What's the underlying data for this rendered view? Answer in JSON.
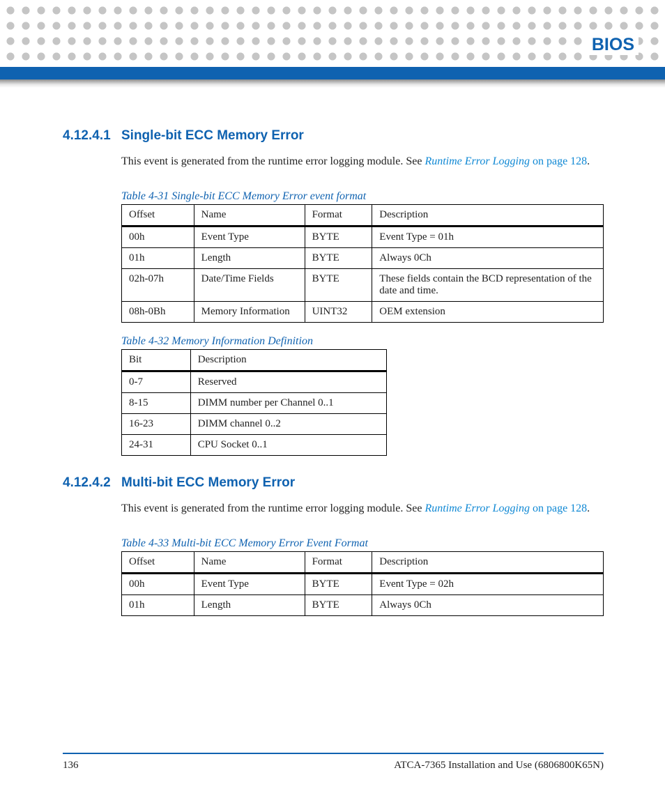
{
  "header": {
    "chapter": "BIOS"
  },
  "sections": [
    {
      "num": "4.12.4.1",
      "title": "Single-bit ECC Memory Error",
      "para_prefix": "This event is generated from the runtime error logging module. See ",
      "xref_text": "Runtime Error Logging",
      "para_mid": " on page 128",
      "para_suffix": "."
    },
    {
      "num": "4.12.4.2",
      "title": "Multi-bit ECC Memory Error",
      "para_prefix": "This event is generated from the runtime error logging module. See ",
      "xref_text": "Runtime Error Logging",
      "para_mid": " on page 128",
      "para_suffix": "."
    }
  ],
  "table431": {
    "caption": "Table 4-31 Single-bit ECC Memory Error event format",
    "headers": [
      "Offset",
      "Name",
      "Format",
      "Description"
    ],
    "rows": [
      [
        "00h",
        "Event Type",
        "BYTE",
        "Event Type = 01h"
      ],
      [
        "01h",
        "Length",
        "BYTE",
        "Always 0Ch"
      ],
      [
        "02h-07h",
        "Date/Time Fields",
        "BYTE",
        "These fields contain the BCD representation of the date and time."
      ],
      [
        "08h-0Bh",
        "Memory Information",
        "UINT32",
        "OEM extension"
      ]
    ]
  },
  "table432": {
    "caption": "Table 4-32 Memory Information Definition",
    "headers": [
      "Bit",
      "Description"
    ],
    "rows": [
      [
        "0-7",
        "Reserved"
      ],
      [
        "8-15",
        "DIMM number per Channel 0..1"
      ],
      [
        "16-23",
        "DIMM channel 0..2"
      ],
      [
        "24-31",
        "CPU Socket 0..1"
      ]
    ]
  },
  "table433": {
    "caption": "Table 4-33 Multi-bit ECC Memory Error Event Format",
    "headers": [
      "Offset",
      "Name",
      "Format",
      "Description"
    ],
    "rows": [
      [
        "00h",
        "Event Type",
        "BYTE",
        "Event Type = 02h"
      ],
      [
        "01h",
        "Length",
        "BYTE",
        "Always 0Ch"
      ]
    ]
  },
  "footer": {
    "page": "136",
    "doc": "ATCA-7365 Installation and Use (6806800K65N)"
  }
}
